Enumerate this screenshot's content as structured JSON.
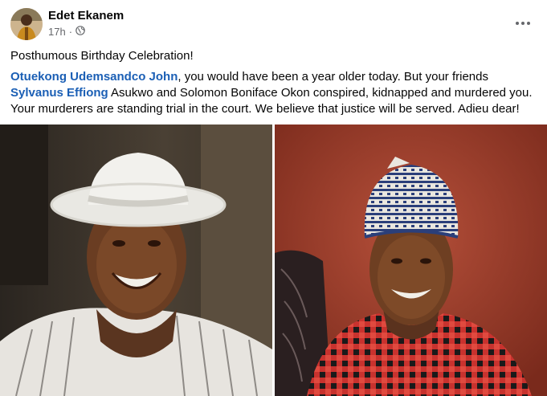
{
  "post": {
    "author": "Edet Ekanem",
    "time": "17h",
    "dot": "·",
    "privacy_icon": "globe-icon",
    "more_icon": "ellipsis-icon",
    "headline": "Posthumous Birthday Celebration!",
    "body": {
      "mention1": "Otuekong Udemsandco John",
      "part1": ", you would have been a year older today. But your friends ",
      "mention2": "Sylvanus Effiong",
      "part2": " Asukwo and Solomon Boniface Okon conspired, kidnapped and murdered you. Your murderers are standing trial in the court. We believe that justice will be served. Adieu dear!"
    },
    "colors": {
      "mention": "#1b5fb5",
      "meta": "#65676b"
    }
  }
}
